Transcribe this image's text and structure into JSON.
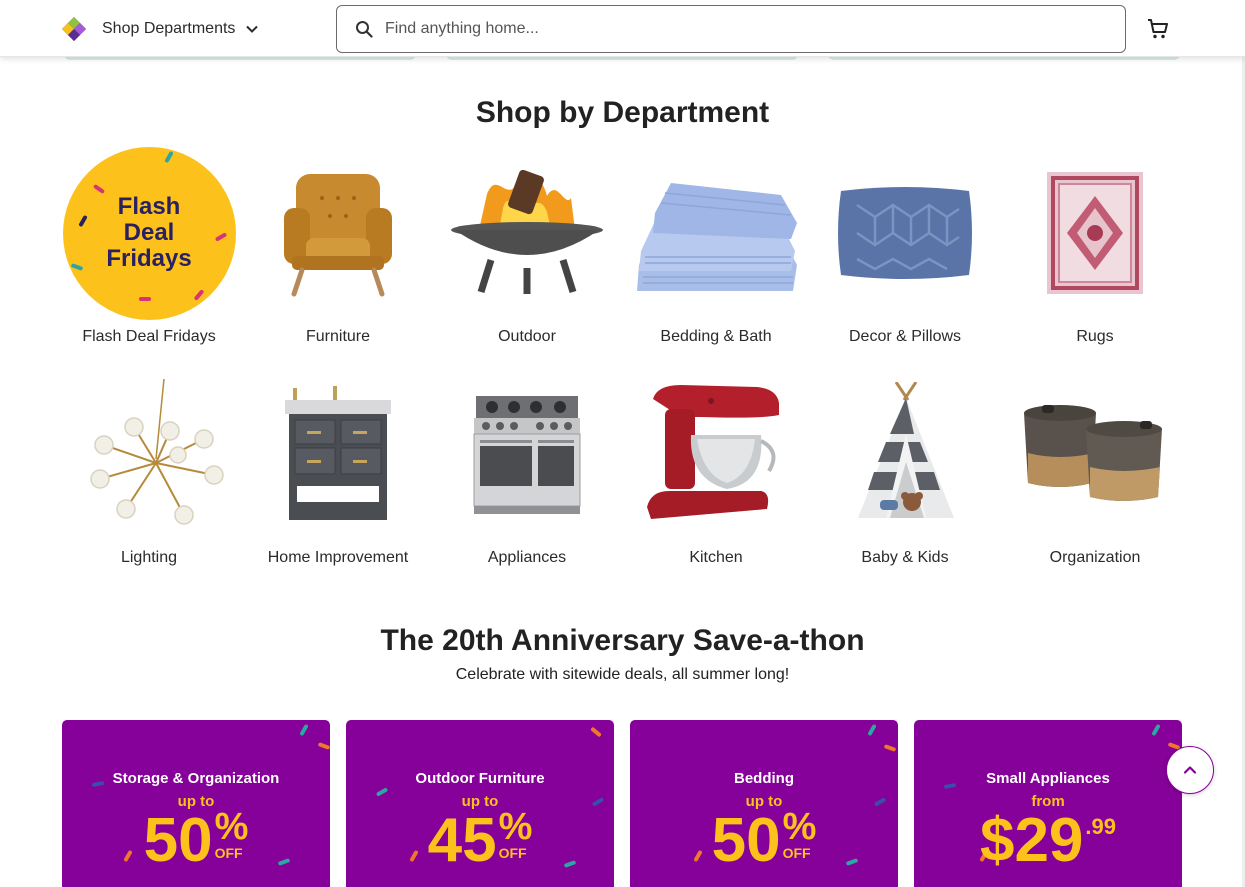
{
  "header": {
    "shop_departments_label": "Shop Departments",
    "search_placeholder": "Find anything home...",
    "cart_icon": "cart-icon"
  },
  "departments_section": {
    "title": "Shop by Department",
    "items": [
      {
        "label": "Flash Deal Fridays",
        "icon": "flash-deal-badge",
        "badge_text": [
          "Flash",
          "Deal",
          "Fridays"
        ]
      },
      {
        "label": "Furniture",
        "icon": "armchair-image"
      },
      {
        "label": "Outdoor",
        "icon": "fire-pit-image"
      },
      {
        "label": "Bedding & Bath",
        "icon": "sheets-image"
      },
      {
        "label": "Decor & Pillows",
        "icon": "pillow-image"
      },
      {
        "label": "Rugs",
        "icon": "rug-image"
      },
      {
        "label": "Lighting",
        "icon": "chandelier-image"
      },
      {
        "label": "Home Improvement",
        "icon": "vanity-image"
      },
      {
        "label": "Appliances",
        "icon": "range-oven-image"
      },
      {
        "label": "Kitchen",
        "icon": "stand-mixer-image"
      },
      {
        "label": "Baby & Kids",
        "icon": "teepee-image"
      },
      {
        "label": "Organization",
        "icon": "baskets-image"
      }
    ]
  },
  "anniversary_section": {
    "title": "The 20th Anniversary Save-a-thon",
    "subtitle": "Celebrate with sitewide deals, all summer long!",
    "promos": [
      {
        "category": "Storage & Organization",
        "prefix": "up to",
        "amount": "50",
        "symbol": "%",
        "suffix": "OFF"
      },
      {
        "category": "Outdoor Furniture",
        "prefix": "up to",
        "amount": "45",
        "symbol": "%",
        "suffix": "OFF"
      },
      {
        "category": "Bedding",
        "prefix": "up to",
        "amount": "50",
        "symbol": "%",
        "suffix": "OFF"
      },
      {
        "category": "Small Appliances",
        "prefix": "from",
        "amount": "$29",
        "cents": ".99"
      }
    ]
  },
  "colors": {
    "brand_purple": "#86009a",
    "promo_yellow": "#fcc21b",
    "text_dark": "#222222"
  }
}
